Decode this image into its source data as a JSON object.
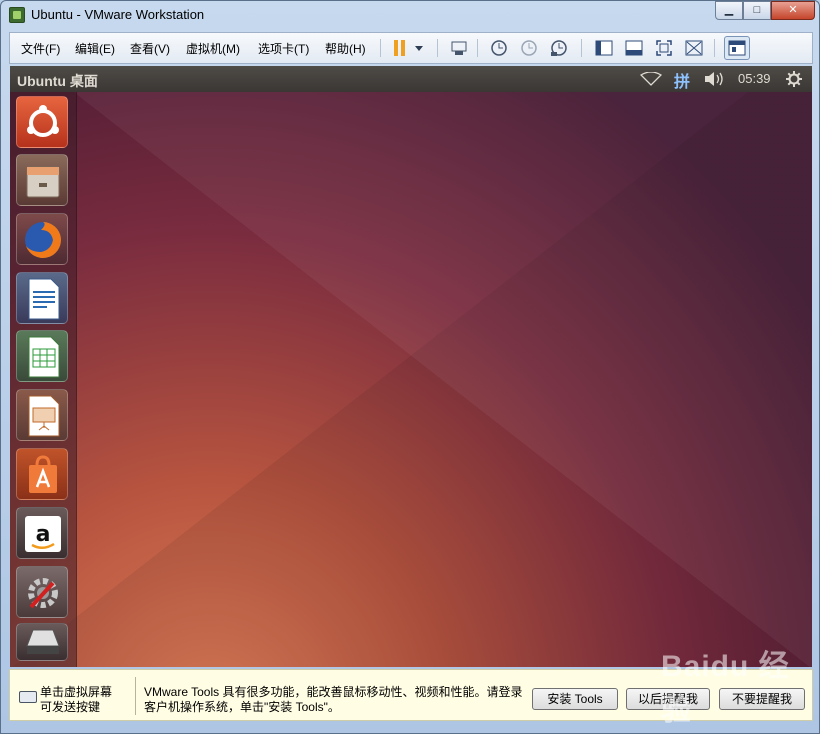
{
  "window": {
    "title": "Ubuntu - VMware Workstation"
  },
  "window_controls": {
    "minimize": "▁",
    "maximize": "□",
    "close": "✕"
  },
  "menu": {
    "items": [
      "文件(F)",
      "编辑(E)",
      "查看(V)",
      "虚拟机(M)",
      "选项卡(T)",
      "帮助(H)"
    ]
  },
  "toolbar": {
    "icons": [
      "pause-icon",
      "dropdown-arrow-icon",
      "send-ctrl-alt-del-icon",
      "snapshot-take-icon",
      "snapshot-revert-icon",
      "snapshot-manager-icon",
      "console-view-icon",
      "quick-switch-icon",
      "fullscreen-icon",
      "unity-icon",
      "thumbnail-view-icon"
    ],
    "pause_color": "#f0a020"
  },
  "ubuntu": {
    "topbar_title": "Ubuntu 桌面",
    "input_method": "拼",
    "time": "05:39",
    "indicators": [
      "network-icon",
      "input-method-icon",
      "volume-icon",
      "settings-gear-icon"
    ],
    "launcher": [
      "dash-home-icon",
      "files-icon",
      "firefox-icon",
      "libreoffice-writer-icon",
      "libreoffice-calc-icon",
      "libreoffice-impress-icon",
      "software-center-icon",
      "amazon-icon",
      "system-settings-icon",
      "drive-icon"
    ]
  },
  "infobar": {
    "hint": "单击虚拟屏幕\n可发送按键",
    "message": "VMware Tools 具有很多功能，能改善鼠标移动性、视频和性能。请登录客户机操作系统，单击\"安装 Tools\"。",
    "buttons": [
      "安装 Tools",
      "以后提醒我",
      "不要提醒我"
    ]
  },
  "watermark": "Baidu 经验",
  "colors": {
    "ubuntu_orange": "#dd4814",
    "desktop_dark": "#3e1632",
    "infobar_bg": "#fffde3"
  }
}
